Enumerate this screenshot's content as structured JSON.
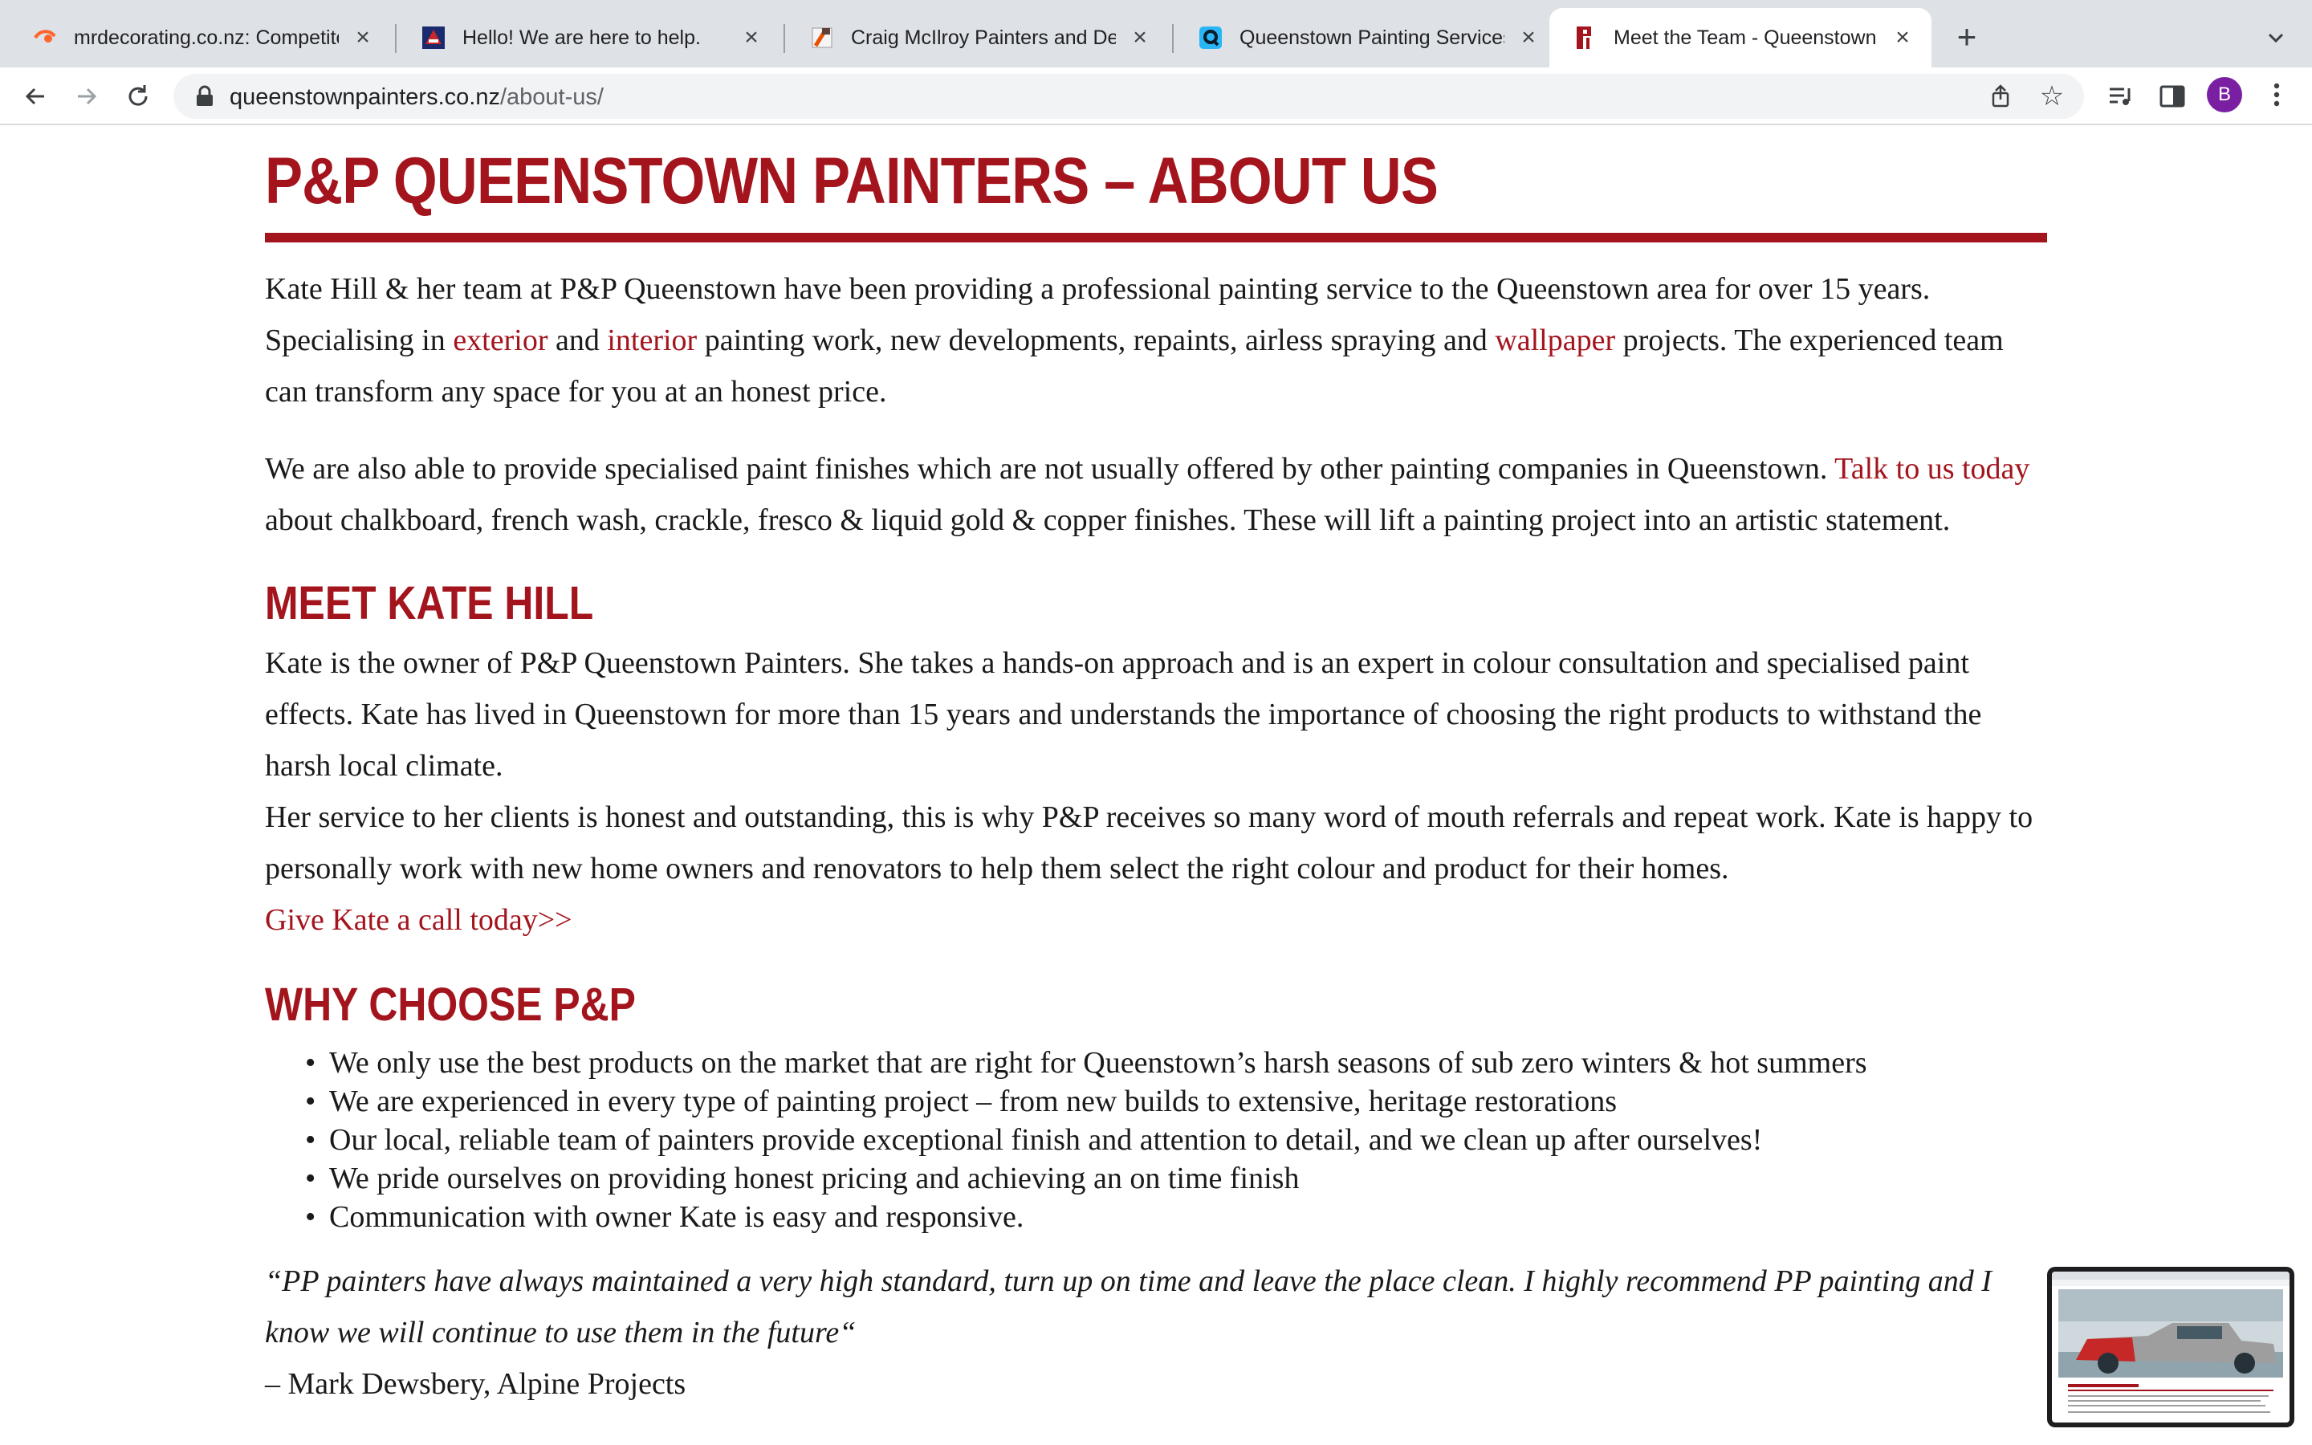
{
  "browser": {
    "tabs": [
      {
        "title": "mrdecorating.co.nz: Competito",
        "favicon": "semrush-icon",
        "active": false
      },
      {
        "title": "Hello! We are here to help.",
        "favicon": "site-logo-icon",
        "active": false
      },
      {
        "title": "Craig McIlroy Painters and Dec",
        "favicon": "paint-brush-icon",
        "active": false
      },
      {
        "title": "Queenstown Painting Services",
        "favicon": "q-logo-icon",
        "active": false
      },
      {
        "title": "Meet the Team - Queenstown P",
        "favicon": "pp-logo-icon",
        "active": true
      }
    ],
    "url_domain": "queenstownpainters.co.nz",
    "url_path": "/about-us/",
    "profile_initial": "B",
    "colors": {
      "tabbar": "#dee1e6",
      "profile": "#7b1fa2"
    }
  },
  "page": {
    "title": "P&P QUEENSTOWN PAINTERS – ABOUT US",
    "intro": {
      "t1": "Kate Hill & her team at P&P Queenstown have been providing a professional painting service to the Queenstown area for over 15 years. Specialising in ",
      "link_exterior": "exterior",
      "t2": " and ",
      "link_interior": "interior",
      "t3": " painting work, new developments, repaints, airless spraying and ",
      "link_wallpaper": "wallpaper",
      "t4": " projects. The experienced team can transform any space for you at an honest price."
    },
    "finishes": {
      "t1": "We are also able to provide specialised paint finishes which are not usually offered by other painting companies in Queenstown. ",
      "link_talk": "Talk to us today",
      "t2": " about chalkboard, french wash, crackle, fresco & liquid gold & copper finishes. These will lift a painting project into an artistic statement."
    },
    "meet_heading": "MEET KATE HILL",
    "kate_p1": "Kate is the owner of P&P Queenstown Painters. She takes a hands-on approach and is an expert in colour consultation and specialised paint effects. Kate has lived in Queenstown for more than 15 years and understands the importance of choosing the right products to withstand the harsh local climate.",
    "kate_p2": "Her service to her clients is honest and outstanding, this is why P&P receives so many word of mouth referrals and repeat work. Kate is happy to personally work with new home owners and renovators to help them select the right colour and product for their homes.",
    "call_link": "Give Kate a call today>>",
    "why_heading": "WHY CHOOSE P&P",
    "benefits": [
      "We only use the best products on the market that are right for Queenstown’s harsh seasons of sub zero winters & hot summers",
      "We are experienced in every type of painting project – from new builds to extensive, heritage restorations",
      "Our local, reliable team of painters provide exceptional finish and attention to detail, and we clean up after ourselves!",
      "We pride ourselves on providing honest pricing and achieving an on time finish",
      "Communication with owner Kate is easy and responsive."
    ],
    "testimonial": "“PP painters have always maintained a very high standard, turn up on time and leave the place clean. I highly recommend PP painting and I know we will continue to use them in the future“",
    "testimonial_author": "– Mark Dewsbery, Alpine Projects",
    "thumbnail_title": "P&P QUEENSTOWN PAINTERS – ABOUT US",
    "colors": {
      "accent": "#a3141d",
      "text": "#1a1a1a"
    }
  }
}
